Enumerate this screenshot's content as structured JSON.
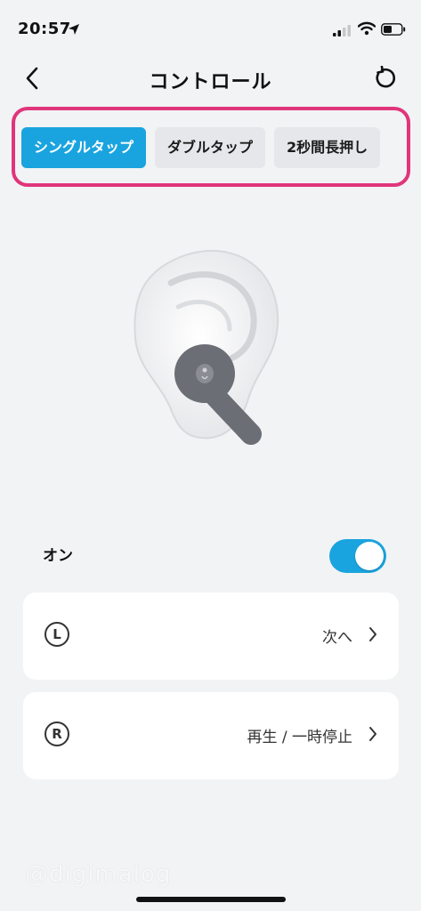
{
  "status_bar": {
    "time": "20:57",
    "icons": [
      "location-arrow-icon",
      "signal-bars-icon",
      "wifi-icon",
      "battery-icon"
    ]
  },
  "nav": {
    "title": "コントロール",
    "back_icon": "chevron-left-icon",
    "reset_icon": "rotate-left-icon"
  },
  "tabs": [
    {
      "label": "シングルタップ",
      "active": true
    },
    {
      "label": "ダブルタップ",
      "active": false
    },
    {
      "label": "2秒間長押し",
      "active": false
    }
  ],
  "toggle": {
    "label": "オン",
    "state": true
  },
  "controls": {
    "left": {
      "side_letter": "L",
      "action": "次へ"
    },
    "right": {
      "side_letter": "R",
      "action": "再生 / 一時停止"
    }
  },
  "watermark": "@digimalog",
  "colors": {
    "accent": "#1aa4df",
    "highlight_border": "#e0357a",
    "background": "#f2f3f5",
    "earbud": "#6b6e75"
  }
}
